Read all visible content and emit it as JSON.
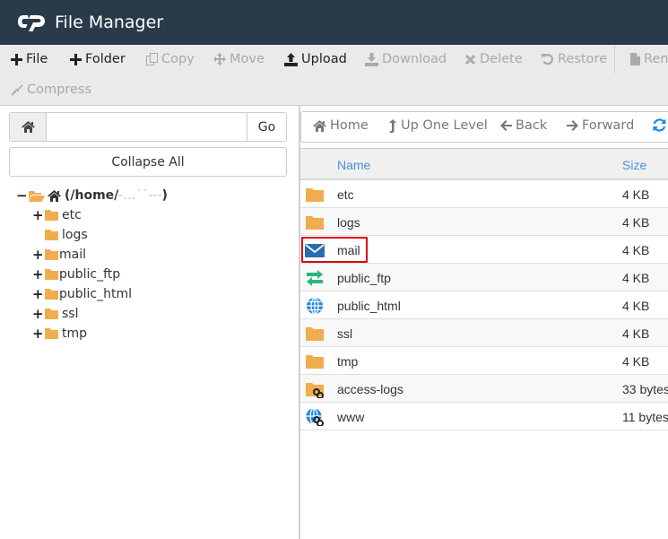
{
  "app": {
    "title": "File Manager",
    "logo": "cpanel-logo"
  },
  "toolbar": {
    "buttons": [
      {
        "label": "File",
        "icon": "plus-icon",
        "enabled": true
      },
      {
        "label": "Folder",
        "icon": "plus-icon",
        "enabled": true
      },
      {
        "label": "Copy",
        "icon": "copy-icon",
        "enabled": false
      },
      {
        "label": "Move",
        "icon": "move-icon",
        "enabled": false
      },
      {
        "label": "Upload",
        "icon": "upload-icon",
        "enabled": true
      },
      {
        "label": "Download",
        "icon": "download-icon",
        "enabled": false
      },
      {
        "label": "Delete",
        "icon": "close-icon",
        "enabled": false
      },
      {
        "label": "Restore",
        "icon": "undo-icon",
        "enabled": false
      },
      {
        "label": "Rena",
        "icon": "file-icon",
        "enabled": false
      },
      {
        "label": "Compress",
        "icon": "compress-icon",
        "enabled": false
      }
    ]
  },
  "sidebar": {
    "path_input": {
      "value": "",
      "placeholder": ""
    },
    "go_label": "Go",
    "collapse_label": "Collapse All",
    "tree": {
      "root": {
        "label": "(/home/",
        "redacted_suffix": "‐…˙˙‐‐‐",
        "close": ")",
        "toggle": "−"
      },
      "children": [
        {
          "label": "etc",
          "toggle": "+"
        },
        {
          "label": "logs",
          "toggle": ""
        },
        {
          "label": "mail",
          "toggle": "+"
        },
        {
          "label": "public_ftp",
          "toggle": "+"
        },
        {
          "label": "public_html",
          "toggle": "+"
        },
        {
          "label": "ssl",
          "toggle": "+"
        },
        {
          "label": "tmp",
          "toggle": "+"
        }
      ]
    }
  },
  "nav": {
    "home": "Home",
    "up": "Up One Level",
    "back": "Back",
    "forward": "Forward",
    "reload_icon": "refresh-icon"
  },
  "table": {
    "columns": {
      "name": "Name",
      "size": "Size"
    },
    "rows": [
      {
        "name": "etc",
        "size": "4 KB",
        "icon": "folder-icon"
      },
      {
        "name": "logs",
        "size": "4 KB",
        "icon": "folder-icon"
      },
      {
        "name": "mail",
        "size": "4 KB",
        "icon": "mail-icon",
        "highlighted": true
      },
      {
        "name": "public_ftp",
        "size": "4 KB",
        "icon": "transfer-icon"
      },
      {
        "name": "public_html",
        "size": "4 KB",
        "icon": "globe-icon"
      },
      {
        "name": "ssl",
        "size": "4 KB",
        "icon": "folder-icon"
      },
      {
        "name": "tmp",
        "size": "4 KB",
        "icon": "folder-icon"
      },
      {
        "name": "access-logs",
        "size": "33 bytes",
        "icon": "folder-link-icon"
      },
      {
        "name": "www",
        "size": "11 bytes",
        "icon": "globe-link-icon"
      }
    ]
  },
  "colors": {
    "header_bg": "#293a4a",
    "toolbar_bg": "#eaeaea",
    "folder": "#f0ad4e",
    "mail": "#2a6cb0",
    "transfer": "#2bb57a",
    "globe": "#1e88e5",
    "highlight": "#e0000b",
    "column_header": "#4a90d9"
  }
}
